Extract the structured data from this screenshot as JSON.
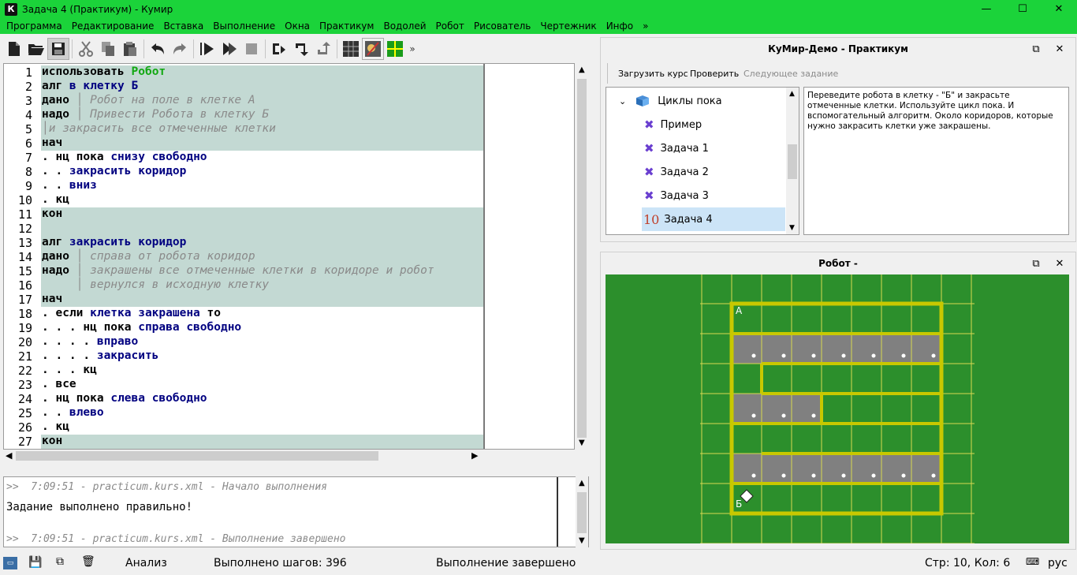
{
  "window": {
    "title": "Задача 4 (Практикум) - Кумир",
    "app_icon": "К",
    "minimize": "—",
    "maximize": "☐",
    "close": "✕"
  },
  "menu": [
    "Программа",
    "Редактирование",
    "Вставка",
    "Выполнение",
    "Окна",
    "Практикум",
    "Водолей",
    "Робот",
    "Рисователь",
    "Чертежник",
    "Инфо",
    "»"
  ],
  "toolbar": {
    "more": "»"
  },
  "editor": {
    "lines": [
      {
        "n": "1",
        "parts": [
          [
            "kw",
            "использовать "
          ],
          [
            "rb",
            "Робот"
          ]
        ],
        "band": true
      },
      {
        "n": "2",
        "parts": [
          [
            "kw",
            "алг "
          ],
          [
            "nm",
            "в клетку Б"
          ]
        ],
        "band": true
      },
      {
        "n": "3",
        "parts": [
          [
            "kw",
            "дано"
          ],
          [
            "cm",
            " │ Робот на поле в клетке А"
          ]
        ],
        "band": true
      },
      {
        "n": "4",
        "parts": [
          [
            "kw",
            "надо"
          ],
          [
            "cm",
            " │ Привести Робота в клетку Б"
          ]
        ],
        "band": true
      },
      {
        "n": "5",
        "parts": [
          [
            "cm",
            "│и закрасить все отмеченные клетки"
          ]
        ],
        "band": true
      },
      {
        "n": "6",
        "parts": [
          [
            "kw",
            "нач"
          ]
        ],
        "band": true
      },
      {
        "n": "7",
        "parts": [
          [
            "kw",
            ". нц пока "
          ],
          [
            "nm",
            "снизу свободно"
          ]
        ],
        "band": false
      },
      {
        "n": "8",
        "parts": [
          [
            "kw",
            ". . "
          ],
          [
            "nm",
            "закрасить коридор"
          ]
        ],
        "band": false
      },
      {
        "n": "9",
        "parts": [
          [
            "kw",
            ". . "
          ],
          [
            "nm",
            "вниз"
          ]
        ],
        "band": false
      },
      {
        "n": "10",
        "parts": [
          [
            "kw",
            ". кц"
          ]
        ],
        "band": false
      },
      {
        "n": "11",
        "parts": [
          [
            "kw",
            "кон"
          ]
        ],
        "band": true
      },
      {
        "n": "12",
        "parts": [
          [
            "kw",
            ""
          ]
        ],
        "band": true
      },
      {
        "n": "13",
        "parts": [
          [
            "kw",
            "алг "
          ],
          [
            "nm",
            "закрасить коридор"
          ]
        ],
        "band": true
      },
      {
        "n": "14",
        "parts": [
          [
            "kw",
            "дано"
          ],
          [
            "cm",
            " │ справа от робота коридор"
          ]
        ],
        "band": true
      },
      {
        "n": "15",
        "parts": [
          [
            "kw",
            "надо"
          ],
          [
            "cm",
            " │ закрашены все отмеченные клетки в коридоре и робот"
          ]
        ],
        "band": true
      },
      {
        "n": "16",
        "parts": [
          [
            "cm",
            "     │ вернулся в исходную клетку"
          ]
        ],
        "band": true
      },
      {
        "n": "17",
        "parts": [
          [
            "kw",
            "нач"
          ]
        ],
        "band": true
      },
      {
        "n": "18",
        "parts": [
          [
            "kw",
            ". если "
          ],
          [
            "nm",
            "клетка закрашена"
          ],
          [
            "kw",
            " то"
          ]
        ],
        "band": false
      },
      {
        "n": "19",
        "parts": [
          [
            "kw",
            ". . . нц пока "
          ],
          [
            "nm",
            "справа свободно"
          ]
        ],
        "band": false
      },
      {
        "n": "20",
        "parts": [
          [
            "kw",
            ". . . . "
          ],
          [
            "nm",
            "вправо"
          ]
        ],
        "band": false
      },
      {
        "n": "21",
        "parts": [
          [
            "kw",
            ". . . . "
          ],
          [
            "nm",
            "закрасить"
          ]
        ],
        "band": false
      },
      {
        "n": "22",
        "parts": [
          [
            "kw",
            ". . . кц"
          ]
        ],
        "band": false
      },
      {
        "n": "23",
        "parts": [
          [
            "kw",
            ". все"
          ]
        ],
        "band": false
      },
      {
        "n": "24",
        "parts": [
          [
            "kw",
            ". нц пока "
          ],
          [
            "nm",
            "слева свободно"
          ]
        ],
        "band": false
      },
      {
        "n": "25",
        "parts": [
          [
            "kw",
            ". . "
          ],
          [
            "nm",
            "влево"
          ]
        ],
        "band": false
      },
      {
        "n": "26",
        "parts": [
          [
            "kw",
            ". кц"
          ]
        ],
        "band": false
      },
      {
        "n": "27",
        "parts": [
          [
            "kw",
            "кон"
          ]
        ],
        "band": true
      }
    ]
  },
  "console": {
    "line1": ">>  7:09:51 - practicum.kurs.xml - Начало выполнения",
    "line2": "Задание выполнено правильно!",
    "line3": ">>  7:09:51 - practicum.kurs.xml - Выполнение завершено"
  },
  "status": {
    "mode": "Анализ",
    "steps": "Выполнено шагов: 396",
    "state": "Выполнение завершено",
    "position": "Стр: 10, Кол: 6",
    "lang": "рус"
  },
  "practicum": {
    "title": "КуМир-Демо - Практикум",
    "load_course": "Загрузить курс",
    "check": "Проверить",
    "next_task": "Следующее задание",
    "tree": {
      "group": "Циклы пока",
      "items": [
        "Пример",
        "Задача 1",
        "Задача 2",
        "Задача 3",
        "Задача 4"
      ],
      "current_mark": "10"
    },
    "description": "Переведите робота в клетку - \"Б\" и закрасьте отмеченные клетки. Используйте цикл пока. И вспомогательный алгоритм. Около коридоров, которые нужно закрасить клетки уже закрашены."
  },
  "robot": {
    "title": "Робот -",
    "label_a": "А",
    "label_b": "Б",
    "colors": {
      "field": "#2c8f2c",
      "wall": "#c8c800",
      "painted": "#808080",
      "grid": "#d8d850"
    }
  }
}
